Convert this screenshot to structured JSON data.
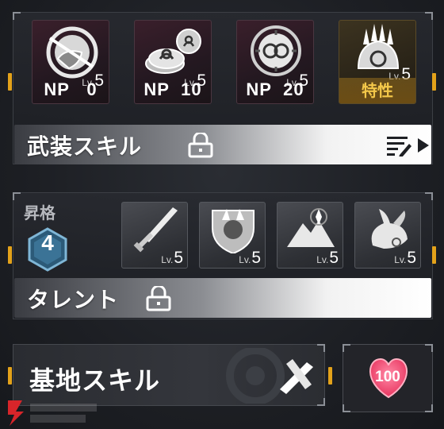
{
  "weapon_skills": {
    "cards": [
      {
        "level_prefix": "Lv.",
        "level": "5",
        "label": "NP   0",
        "icon": "hand-slash-skill-icon"
      },
      {
        "level_prefix": "Lv.",
        "level": "5",
        "label": "NP  10",
        "icon": "double-orb-skill-icon"
      },
      {
        "level_prefix": "Lv.",
        "level": "5",
        "label": "NP  20",
        "icon": "linked-rings-skill-icon"
      },
      {
        "level_prefix": "Lv.",
        "level": "5",
        "label": "特性",
        "icon": "crown-hand-trait-icon"
      }
    ],
    "bar_title": "武装スキル"
  },
  "ascension": {
    "label": "昇格",
    "rank": "4",
    "talents": [
      {
        "level_prefix": "Lv.",
        "level": "5",
        "icon": "sword-talent-icon"
      },
      {
        "level_prefix": "Lv.",
        "level": "5",
        "icon": "shield-talent-icon"
      },
      {
        "level_prefix": "Lv.",
        "level": "5",
        "icon": "mountain-talent-icon"
      },
      {
        "level_prefix": "Lv.",
        "level": "5",
        "icon": "rabbit-talent-icon"
      }
    ],
    "bar_title": "タレント"
  },
  "base": {
    "title": "基地スキル",
    "heart_value": "100"
  },
  "colors": {
    "accent_gold": "#e3a21a",
    "heart_pink": "#ff4f7a"
  }
}
